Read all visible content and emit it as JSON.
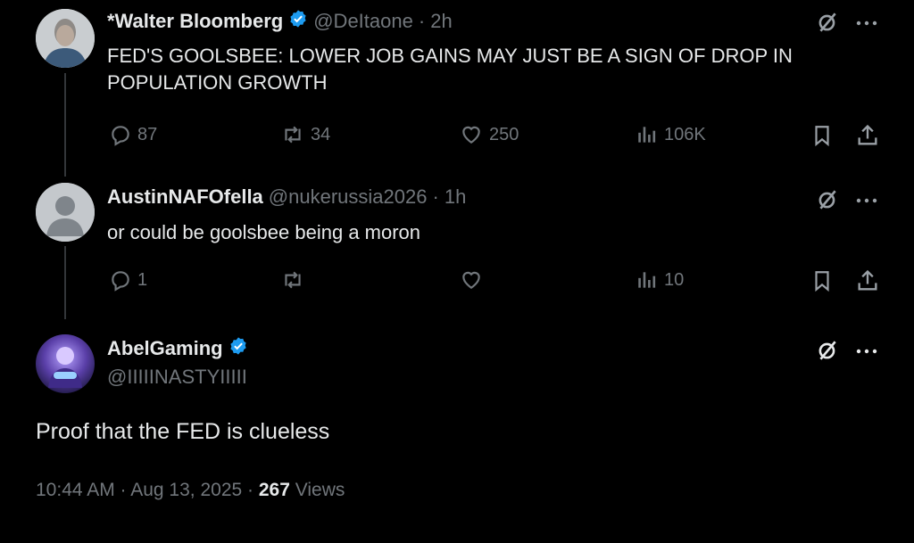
{
  "tweets": [
    {
      "name": "*Walter Bloomberg",
      "handle": "@DeItaone",
      "time": "· 2h",
      "text_lines": [
        "FED'S GOOLSBEE: LOWER JOB GAINS MAY JUST BE A SIGN OF DROP IN",
        "POPULATION GROWTH"
      ],
      "replies": "87",
      "reposts": "34",
      "likes": "250",
      "views": "106K",
      "verified": true
    },
    {
      "name": "AustinNAFOfella",
      "handle": "@nukerussia2026",
      "time": "· 1h",
      "text_lines": [
        "or could be goolsbee being a moron"
      ],
      "replies": "1",
      "reposts": "",
      "likes": "",
      "views": "10",
      "verified": false
    }
  ],
  "main_tweet": {
    "name": "AbelGaming",
    "handle": "@IIIIINASTYIIIII",
    "text": "Proof that the FED is clueless",
    "time": "10:44 AM · Aug 13, 2025 ·",
    "views_count": "267",
    "views_label": "Views",
    "verified": true
  },
  "icons": {
    "reply": "reply-icon",
    "repost": "repost-icon",
    "like": "heart-icon",
    "views": "views-icon",
    "bookmark": "bookmark-icon",
    "share": "share-icon",
    "grok": "grok-icon",
    "more": "more-icon"
  },
  "colors": {
    "background": "#000000",
    "text": "#e7e9ea",
    "muted": "#71767b",
    "verified": "#1d9bf0"
  }
}
